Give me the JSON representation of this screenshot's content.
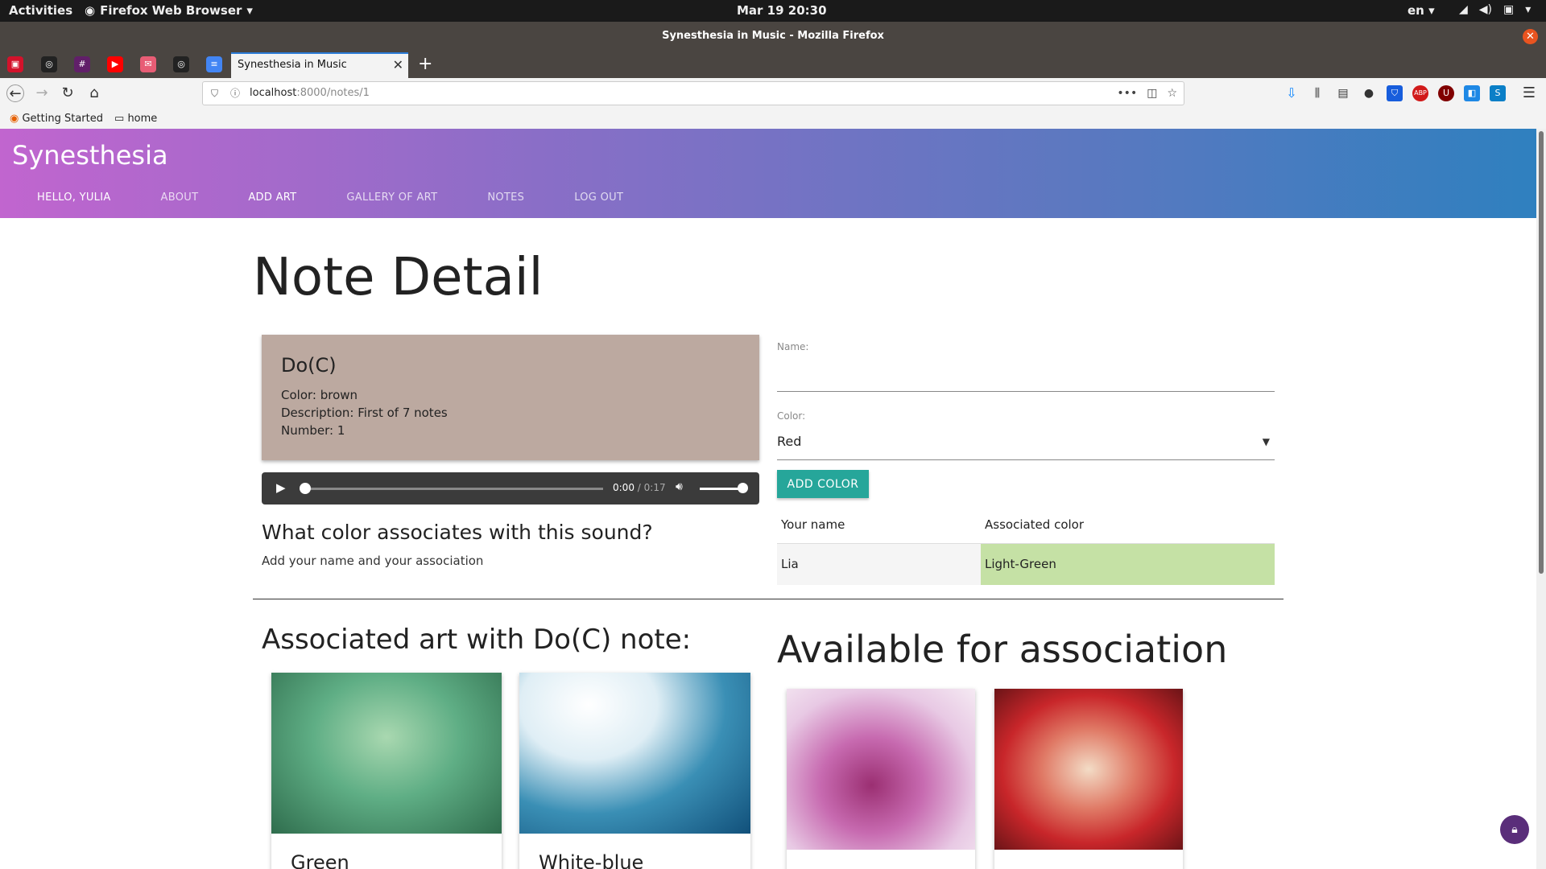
{
  "os": {
    "activities": "Activities",
    "app_menu": "Firefox Web Browser",
    "clock": "Mar 19  20:30",
    "lang": "en"
  },
  "browser": {
    "window_title": "Synesthesia in Music - Mozilla Firefox",
    "active_tab_title": "Synesthesia in Music",
    "url_host": "localhost",
    "url_path": ":8000/notes/1",
    "bookmarks": [
      "Getting Started",
      "home"
    ]
  },
  "site": {
    "brand": "Synesthesia",
    "nav": [
      "HELLO, YULIA",
      "ABOUT",
      "ADD ART",
      "GALLERY OF ART",
      "NOTES",
      "LOG OUT"
    ]
  },
  "page": {
    "title": "Note Detail",
    "note": {
      "name": "Do(C)",
      "color_line": "Color: brown",
      "description_line": "Description: First of 7 notes",
      "number_line": "Number: 1",
      "card_color": "#bca9a0"
    },
    "audio": {
      "current": "0:00",
      "separator": "/",
      "total": "0:17",
      "progress": 0
    },
    "question": "What color associates with this sound?",
    "question_sub": "Add your name and your association",
    "form": {
      "name_label": "Name:",
      "name_value": "",
      "color_label": "Color:",
      "color_value": "Red",
      "submit_label": "ADD COLOR"
    },
    "associations": {
      "headers": [
        "Your name",
        "Associated color"
      ],
      "rows": [
        {
          "name": "Lia",
          "color": "Light-Green",
          "swatch": "#c5e1a5"
        }
      ]
    },
    "associated_heading": "Associated art with Do(C) note:",
    "available_heading": "Available for association",
    "associated_art": [
      {
        "caption": "Green"
      },
      {
        "caption": "White-blue"
      }
    ],
    "available_art": [
      {
        "caption": ""
      },
      {
        "caption": ""
      }
    ]
  },
  "colors": {
    "accent_button": "#26a69a",
    "header_gradient_start": "#c165cf",
    "header_gradient_end": "#2f80bf"
  }
}
